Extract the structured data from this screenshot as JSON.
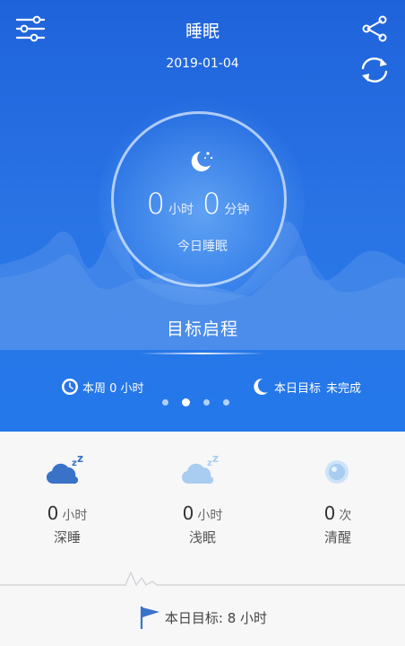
{
  "header": {
    "title": "睡眠",
    "date": "2019-01-04",
    "icons": {
      "menu": "sliders-icon",
      "share": "share-icon",
      "sync": "sync-icon"
    }
  },
  "sleep_summary": {
    "hours": "0",
    "hours_unit": "小时",
    "minutes": "0",
    "minutes_unit": "分钟",
    "label": "今日睡眠"
  },
  "goal": {
    "title": "目标启程",
    "week_label": "本周 0 小时",
    "day_goal_label": "本日目标",
    "day_goal_status": "未完成"
  },
  "pager": {
    "count": 4,
    "active_index": 1
  },
  "stats": [
    {
      "value": "0",
      "unit": "小时",
      "label": "深睡",
      "icon": "deep-sleep-cloud-icon"
    },
    {
      "value": "0",
      "unit": "小时",
      "label": "浅眠",
      "icon": "light-sleep-cloud-icon"
    },
    {
      "value": "0",
      "unit": "次",
      "label": "清醒",
      "icon": "awake-eye-icon"
    }
  ],
  "footer": {
    "target_label": "本日目标: 8 小时"
  },
  "colors": {
    "hero_blue": "#1f63db",
    "icon_dark": "#3a72c8",
    "icon_light": "#a9cdf0",
    "background": "#f7f7f8"
  }
}
